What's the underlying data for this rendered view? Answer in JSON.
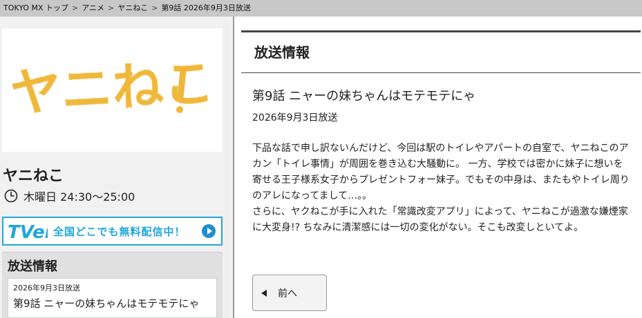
{
  "breadcrumb": {
    "items": [
      "TOKYO MX トップ",
      "アニメ",
      "ヤニねこ",
      "第9話 2026年9月3日放送"
    ],
    "separator": ">"
  },
  "show": {
    "logo_text": "ヤニねこ",
    "title": "ヤニねこ",
    "schedule": "木曜日 24:30～25:00"
  },
  "tver": {
    "logo_text": "TVer",
    "banner_text": "全国どこでも無料配信中！"
  },
  "sidebar_broadcast": {
    "heading": "放送情報",
    "date": "2026年9月3日放送",
    "title": "第9話 ニャーの妹ちゃんはモテモテにゃ"
  },
  "main": {
    "heading": "放送情報",
    "episode_title": "第9話 ニャーの妹ちゃんはモテモテにゃ",
    "episode_date": "2026年9月3日放送",
    "description": "下品な話で申し訳ないんだけど、今回は駅のトイレやアパートの自室で、ヤニねこのアカン「トイレ事情」が周囲を巻き込む大騒動に。 一方、学校では密かに妹子に想いを寄せる王子様系女子からプレゼントフォー妹子。でもその中身は、またもやトイレ周りのアレになってまして…。。\nさらに、ヤクねこが手に入れた「常識改変アプリ」によって、ヤニねこが過激な嫌煙家に大変身!? ちなみに清潔感には一切の変化がない。そこも改変しといてよ。",
    "prev_label": "前へ"
  },
  "colors": {
    "logo_yellow": "#f0b83a",
    "tver_blue": "#1fa7d8",
    "breadcrumb_bg": "#c8c8c8"
  }
}
